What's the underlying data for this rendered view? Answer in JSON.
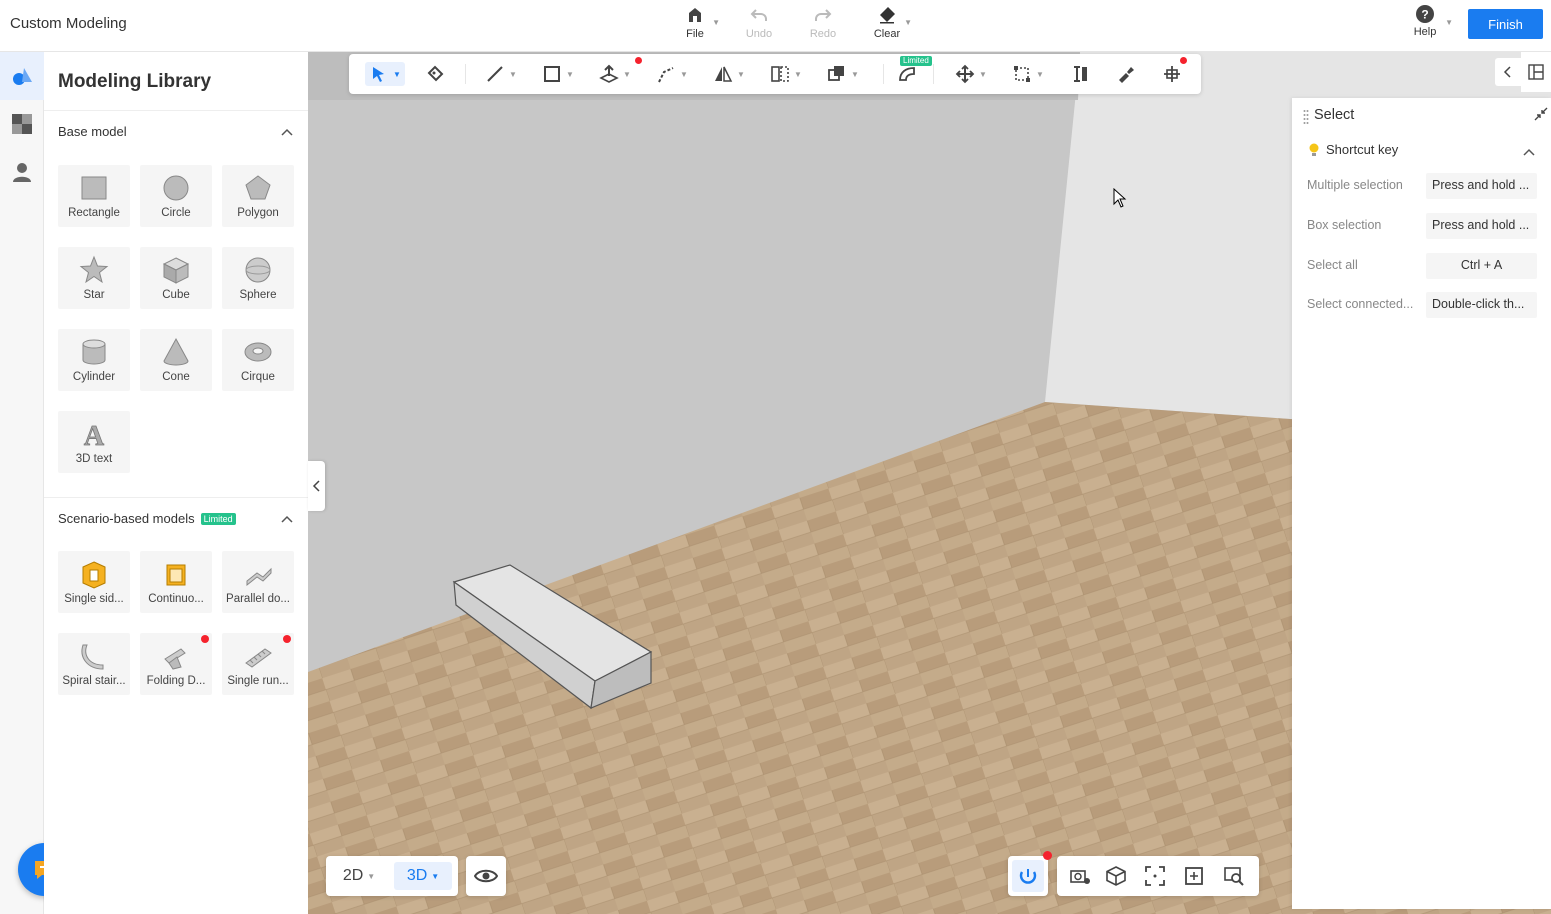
{
  "app": {
    "title": "Custom Modeling"
  },
  "top_actions": [
    {
      "label": "File",
      "icon": "file-home-icon",
      "disabled": false
    },
    {
      "label": "Undo",
      "icon": "undo-icon",
      "disabled": true
    },
    {
      "label": "Redo",
      "icon": "redo-icon",
      "disabled": true
    },
    {
      "label": "Clear",
      "icon": "eraser-icon",
      "disabled": false
    }
  ],
  "help": {
    "label": "Help"
  },
  "finish_label": "Finish",
  "library": {
    "title": "Modeling Library",
    "base_section": "Base model",
    "base_models": [
      "Rectangle",
      "Circle",
      "Polygon",
      "Star",
      "Cube",
      "Sphere",
      "Cylinder",
      "Cone",
      "Cirque",
      "3D text"
    ],
    "scenario_section": "Scenario-based models",
    "limited_tag": "Limited",
    "scenario_models": [
      "Single sid...",
      "Continuo...",
      "Parallel do...",
      "Spiral stair...",
      "Folding D...",
      "Single run..."
    ]
  },
  "toolbar": {
    "limited_tag": "Limited"
  },
  "select_panel": {
    "title": "Select",
    "section": "Shortcut key",
    "shortcuts": [
      {
        "label": "Multiple selection",
        "value": "Press and hold ..."
      },
      {
        "label": "Box selection",
        "value": "Press and hold ..."
      },
      {
        "label": "Select all",
        "value": "Ctrl + A"
      },
      {
        "label": "Select connected...",
        "value": "Double-click th..."
      }
    ]
  },
  "view_switch": {
    "two_d": "2D",
    "three_d": "3D",
    "active": "3D"
  },
  "colors": {
    "accent": "#1a7cf0",
    "limited": "#25c28c",
    "notice": "#f5222d"
  }
}
